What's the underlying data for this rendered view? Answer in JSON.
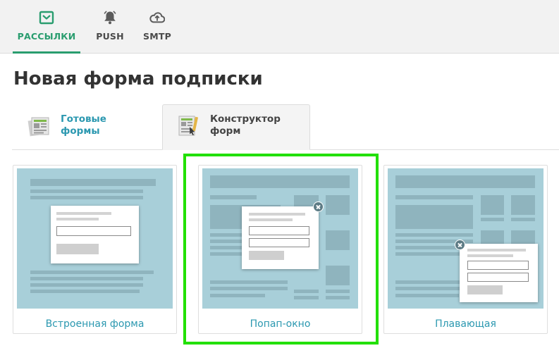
{
  "topnav": {
    "items": [
      {
        "label": "РАССЫЛКИ",
        "icon": "envelope-icon",
        "active": true
      },
      {
        "label": "PUSH",
        "icon": "bell-icon",
        "active": false
      },
      {
        "label": "SMTP",
        "icon": "cloud-upload-icon",
        "active": false
      }
    ],
    "accent_color": "#2a9d6f"
  },
  "page": {
    "title": "Новая форма подписки"
  },
  "tabs": [
    {
      "label": "Готовые\nформы",
      "icon": "ready-forms-icon",
      "active": false
    },
    {
      "label": "Конструктор\nформ",
      "icon": "form-builder-icon",
      "active": true
    }
  ],
  "cards": [
    {
      "caption": "Встроенная форма",
      "preview": "embedded-form-preview",
      "selected": false
    },
    {
      "caption": "Попап-окно",
      "preview": "popup-window-preview",
      "selected": true
    },
    {
      "caption": "Плавающая",
      "preview": "floating-form-preview",
      "selected": false
    }
  ],
  "colors": {
    "link": "#2b98b0",
    "preview_bg": "#a8cfd9",
    "selection_highlight": "#22e000"
  }
}
